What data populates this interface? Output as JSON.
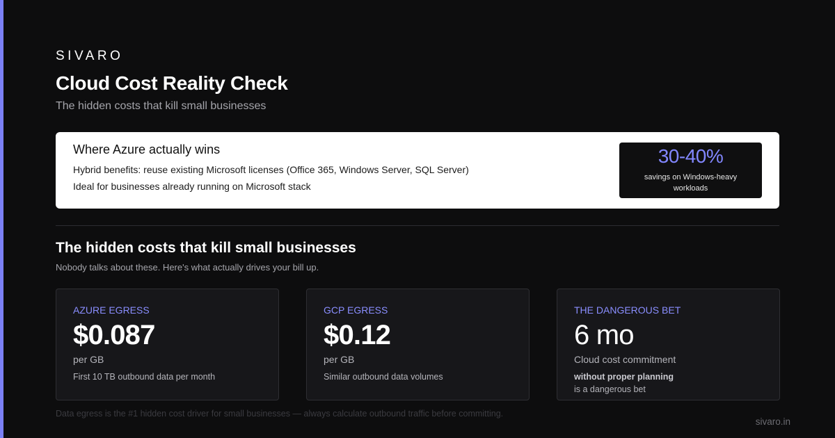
{
  "brand": "SIVARO",
  "header": {
    "title": "Cloud Cost Reality Check",
    "subtitle": "The hidden costs that kill small businesses"
  },
  "azure_card": {
    "heading": "Where Azure actually wins",
    "line1": "Hybrid benefits: reuse existing Microsoft licenses (Office 365, Windows Server, SQL Server)",
    "line2": "Ideal for businesses already running on Microsoft stack",
    "savings_value": "30-40%",
    "savings_caption": "savings on Windows-heavy workloads"
  },
  "section": {
    "title": "The hidden costs that kill small businesses",
    "subtitle": "Nobody talks about these. Here's what actually drives your bill up."
  },
  "stats": [
    {
      "label": "AZURE EGRESS",
      "value": "$0.087",
      "unit": "per GB",
      "note": "First 10 TB outbound data per month"
    },
    {
      "label": "GCP EGRESS",
      "value": "$0.12",
      "unit": "per GB",
      "note": "Similar outbound data volumes"
    },
    {
      "label": "THE DANGEROUS BET",
      "value": "6 mo",
      "unit": "Cloud cost commitment",
      "note_strong": "without proper planning",
      "note": "is a dangerous bet"
    }
  ],
  "footnote": "Data egress is the #1 hidden cost driver for small businesses — always calculate outbound traffic before committing.",
  "site": "sivaro.in",
  "colors": {
    "background": "#0d0d0e",
    "accent": "#7b80f5",
    "card_background": "#17171a",
    "azure_card_background": "#ffffff"
  }
}
